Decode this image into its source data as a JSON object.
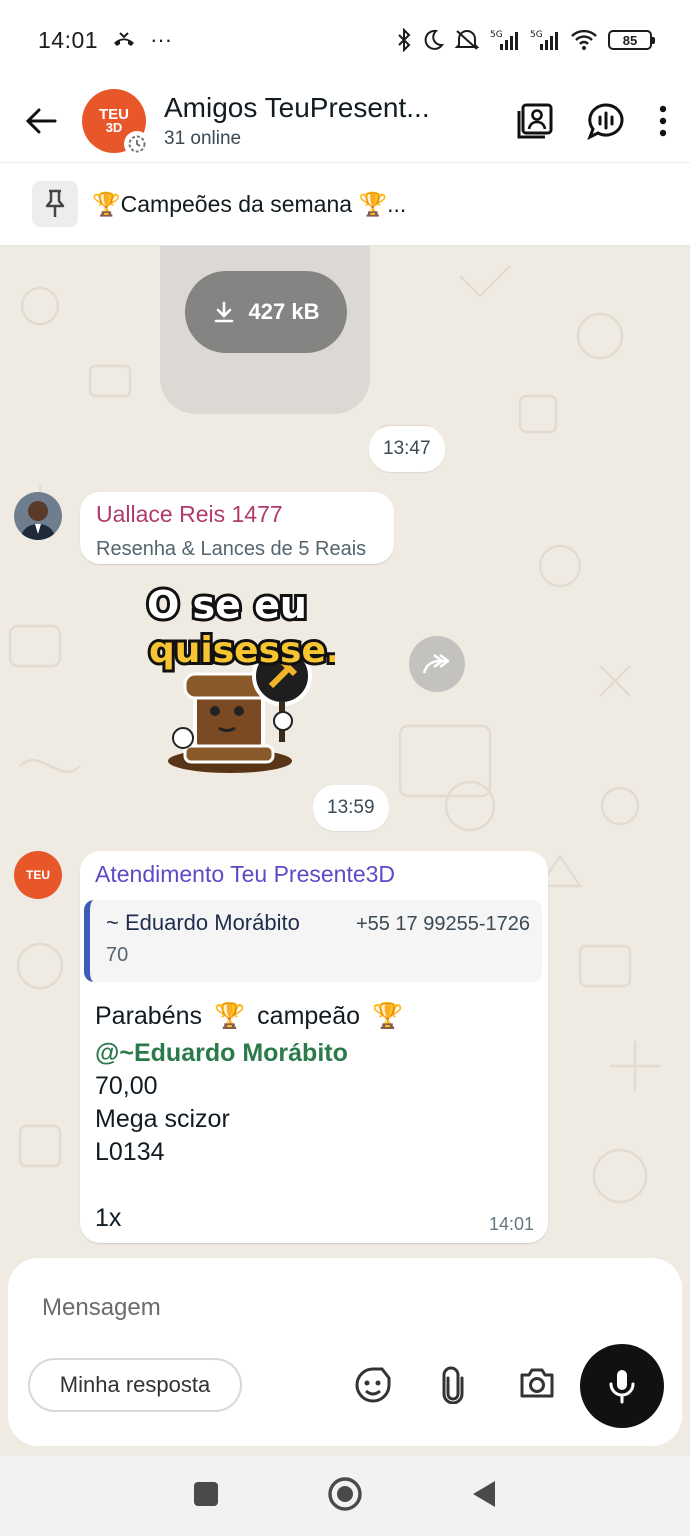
{
  "status_bar": {
    "time": "14:01",
    "battery": "85",
    "signal_label": "5G"
  },
  "header": {
    "title": "Amigos TeuPresent...",
    "subtitle": "31 online",
    "avatar_text_line1": "TEU",
    "avatar_text_line2": "3D"
  },
  "pinned": {
    "text": "🏆Campeões da semana 🏆..."
  },
  "chat": {
    "download_size": "427 kB",
    "time_1": "13:47",
    "msg1": {
      "sender": "Uallace Reis 1477",
      "text": "Resenha & Lances de 5 Reais",
      "sender_color": "#b03a6e"
    },
    "sticker": {
      "line1": "O se eu",
      "line2": "quisesse."
    },
    "time_2": "13:59",
    "msg2": {
      "sender": "Atendimento Teu Presente3D",
      "sender_color": "#5b4bc4",
      "quote_name": "~ Eduardo Morábito",
      "quote_phone": "+55 17 99255-1726",
      "quote_text": "70",
      "line1_a": "Parabéns",
      "trophy": "🏆",
      "line1_b": "campeão",
      "mention": "@~Eduardo Morábito",
      "line3": "70,00",
      "line4": "Mega scizor",
      "line5": "L0134",
      "line6": "1x",
      "time": "14:01"
    }
  },
  "composer": {
    "placeholder": "Mensagem",
    "reply_chip": "Minha resposta"
  },
  "icons": {
    "back": "arrow-left-icon",
    "contacts": "contact-book-icon",
    "voice_chat": "voice-chat-icon",
    "menu": "more-vert-icon",
    "pin": "pin-icon",
    "download": "download-icon",
    "forward": "forward-icon",
    "sticker": "sticker-icon",
    "attach": "paperclip-icon",
    "camera": "camera-icon",
    "mic": "mic-icon"
  }
}
